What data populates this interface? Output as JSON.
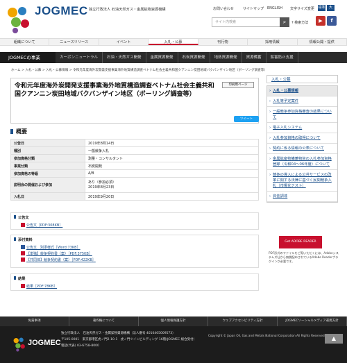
{
  "header": {
    "brand": "JOGMEC",
    "brand_sub": "独立行政法人 石油天然ガス・金属鉱物資源機構",
    "util": [
      "お問い合わせ",
      "サイトマップ",
      "ENGLISH"
    ],
    "fontsize_label": "文字サイズ変更",
    "fontsize_options": [
      "標準",
      "大"
    ],
    "search_placeholder": "サイト内検索",
    "advanced_search": "検索方法"
  },
  "gnav": [
    "組織について",
    "ニュースリリース",
    "イベント",
    "入札・公募",
    "刊行物",
    "採用情報",
    "情報公開・提供"
  ],
  "subnav": [
    "JOGMECの事業",
    "カーボンニュートラル",
    "石油・天然ガス開発",
    "金属資源開発",
    "石炭資源開発",
    "地熱資源開発",
    "資源備蓄",
    "鉱害防止支援"
  ],
  "breadcrumb": "ホーム > 入札・公募 > 入札・公募情報 > 令和元年度海外炭開発支援事業海外地質構造調査ベトナム社会主義共和国クアンニン炭田地域バクバンザイン地区（ボーリング調査等）",
  "page": {
    "title": "令和元年度海外炭開発支援事業海外地質構造調査ベトナム社会主義共和国クアンニン炭田地域バクバンザイン地区（ボーリング調査等）",
    "print": "印刷用ページ",
    "tweet": "ツイート",
    "overview_heading": "概要",
    "overview": [
      {
        "key": "公告日",
        "value": "2019年8月14日"
      },
      {
        "key": "種別",
        "value": "一般競争入札"
      },
      {
        "key": "参加資格分類",
        "value": "測量・コンサルタント"
      },
      {
        "key": "事業分類",
        "value": "石炭開発"
      },
      {
        "key": "参加資格の等級",
        "value": "A/B"
      },
      {
        "key": "説明会の開催および参加",
        "value": "あり（参加必須）\n2019年8月23日"
      },
      {
        "key": "入札日",
        "value": "2019年9月20日"
      }
    ],
    "sections": [
      {
        "heading": "公告文",
        "links": [
          "公告文［PDF:308KB］"
        ]
      },
      {
        "heading": "添付資料",
        "links": [
          "公告文　別添様式［Word:73KB］",
          "【単独】競争契約書（案）［PDF:375KB］",
          "【共同体】競争契約書（案）［PDF:422KB］"
        ]
      },
      {
        "heading": "結果",
        "links": [
          "結果［PDF:78KB］"
        ]
      }
    ]
  },
  "sidebar": {
    "top": "入札・公募",
    "items": [
      "入札・公募情報",
      "入札等予定案件",
      "一般競争参加資格審査の結果について",
      "電子入札システム",
      "入札参加資格の取得について",
      "契約に係る情報の公表について",
      "金属鉱産物備蓄物資の入札参加資格登録（令和04〜06年度）について",
      "競争の導入による公共サービスの改革に関する法律に基づく民間競争入札（市場化テスト）",
      "資金調達"
    ],
    "reader_label": "Get ADOBE READER",
    "reader_note": "PDF形式のファイルをご覧いただくには、Adobeシステムズ社から無償配布されているAdobe Readerプラグインが必要です。"
  },
  "footer": {
    "nav": [
      "免責事項",
      "著作権について",
      "個人情報保護方針",
      "ウェブアクセシビリティ方針",
      "JOGMECソーシャルメディア運用方針"
    ],
    "brand": "JOGMEC",
    "address": [
      "独立行政法人　石油天然ガス・金属鉱物資源機構（法人番号 4010405009573）",
      "〒105-0001　東京都港区虎ノ門2-10-1　虎ノ門ツインビルディング 16階(JOGMEC 総合受付）",
      "電話(代表) 03-6758-8000"
    ],
    "copyright": "Copyright © Japan Oil, Gas and Metals National Corporation All Rights Reserved.",
    "to_top": "▲"
  },
  "colors": {
    "brand": "#1a4f8a",
    "accent": "#c8102e",
    "dark": "#2b2b2b"
  }
}
